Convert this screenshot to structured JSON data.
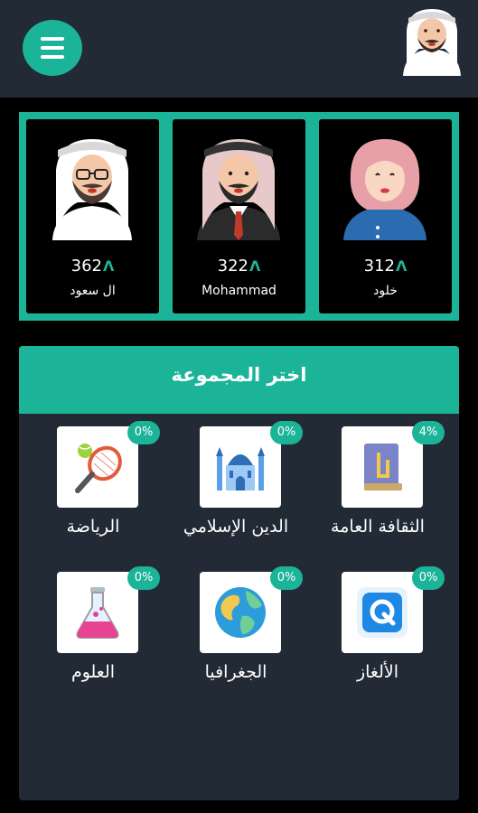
{
  "topbar": {
    "menu_icon": "hamburger-menu-icon",
    "profile_avatar": "user-avatar-icon"
  },
  "leaderboard": {
    "players": [
      {
        "name": "ال سعود",
        "score": "362",
        "coin_icon": "coin-icon"
      },
      {
        "name": "Mohammad",
        "score": "322",
        "coin_icon": "coin-icon"
      },
      {
        "name": "خلود",
        "score": "312",
        "coin_icon": "coin-icon"
      }
    ]
  },
  "groups": {
    "title": "اختر المجموعة",
    "categories": [
      {
        "label": "الثقافة العامة",
        "progress": "4%",
        "icon": "book-icon"
      },
      {
        "label": "الدين الإسلامي",
        "progress": "0%",
        "icon": "mosque-icon"
      },
      {
        "label": "الرياضة",
        "progress": "0%",
        "icon": "tennis-racket-icon"
      },
      {
        "label": "الألغاز",
        "progress": "0%",
        "icon": "puzzle-q-icon"
      },
      {
        "label": "الجغرافيا",
        "progress": "0%",
        "icon": "globe-icon"
      },
      {
        "label": "العلوم",
        "progress": "0%",
        "icon": "flask-icon"
      }
    ]
  },
  "colors": {
    "accent": "#1cb499",
    "topbar_bg": "#222a36",
    "page_bg": "#000000"
  }
}
